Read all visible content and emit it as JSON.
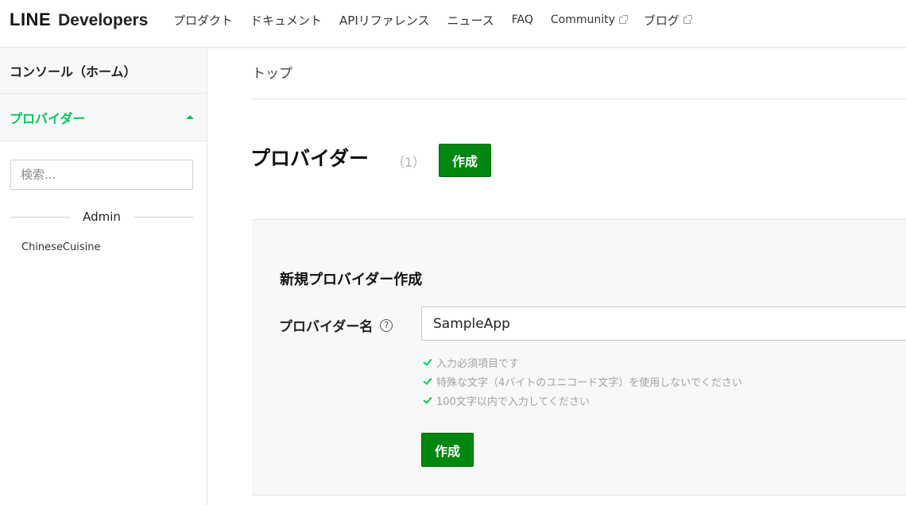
{
  "header": {
    "logo_line": "LINE",
    "logo_developers": "Developers",
    "nav": [
      {
        "label": "プロダクト"
      },
      {
        "label": "ドキュメント"
      },
      {
        "label": "APIリファレンス"
      },
      {
        "label": "ニュース"
      },
      {
        "label": "FAQ"
      },
      {
        "label": "Community"
      },
      {
        "label": "ブログ"
      }
    ]
  },
  "sidebar": {
    "home_label": "コンソール（ホーム）",
    "provider_label": "プロバイダー",
    "search_placeholder": "検索...",
    "group_label": "Admin",
    "items": [
      {
        "label": "ChineseCuisine"
      }
    ]
  },
  "main": {
    "breadcrumb": "トップ",
    "title": "プロバイダー",
    "count": "（1）",
    "create_label": "作成",
    "form": {
      "title": "新規プロバイダー作成",
      "field_label": "プロバイダー名",
      "field_value": "SampleApp",
      "help_glyph": "?",
      "rules": [
        "入力必須項目です",
        "特殊な文字（4バイトのユニコード文字）を使用しないでください",
        "100文字以内で入力してください"
      ],
      "submit_label": "作成"
    }
  },
  "colors": {
    "accent_green": "#06c755",
    "button_green": "#00870f"
  }
}
